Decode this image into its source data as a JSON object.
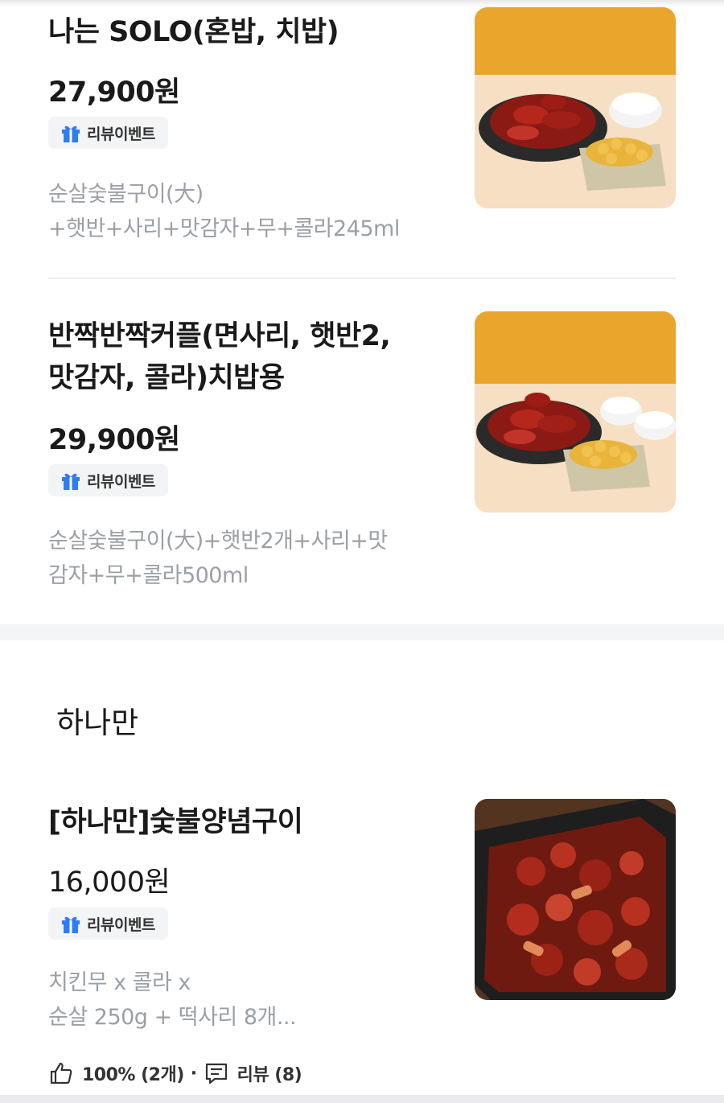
{
  "items": [
    {
      "name": "나는 SOLO(혼밥, 치밥)",
      "price": "27,900원",
      "badge": "리뷰이벤트",
      "desc_lines": [
        "순살숯불구이(大)",
        "+햇반+사리+맛감자+무+콜라245ml"
      ]
    },
    {
      "name_lines": [
        "반짝반짝커플(면사리, 햇반2,",
        "맛감자, 콜라)치밥용"
      ],
      "price": "29,900원",
      "badge": "리뷰이벤트",
      "desc_lines": [
        "순살숯불구이(大)+햇반2개+사리+맛",
        "감자+무+콜라500ml"
      ]
    },
    {
      "name": "[하나만]숯불양념구이",
      "price": "16,000원",
      "badge": "리뷰이벤트",
      "desc_lines": [
        "치킨무 x 콜라 x",
        "순살 250g + 떡사리 8개..."
      ]
    }
  ],
  "section": {
    "title": "하나만"
  },
  "stats": {
    "like_text": "100% (2개)",
    "separator": "·",
    "review_text": "리뷰 (8)"
  },
  "icons": {
    "badge": "gift-icon",
    "like": "thumbs-up-icon",
    "review": "review-chat-icon"
  },
  "colors": {
    "badge_icon": "#2e7cf6",
    "desc_text": "#9aa0a6",
    "band": "#f4f5f7"
  }
}
